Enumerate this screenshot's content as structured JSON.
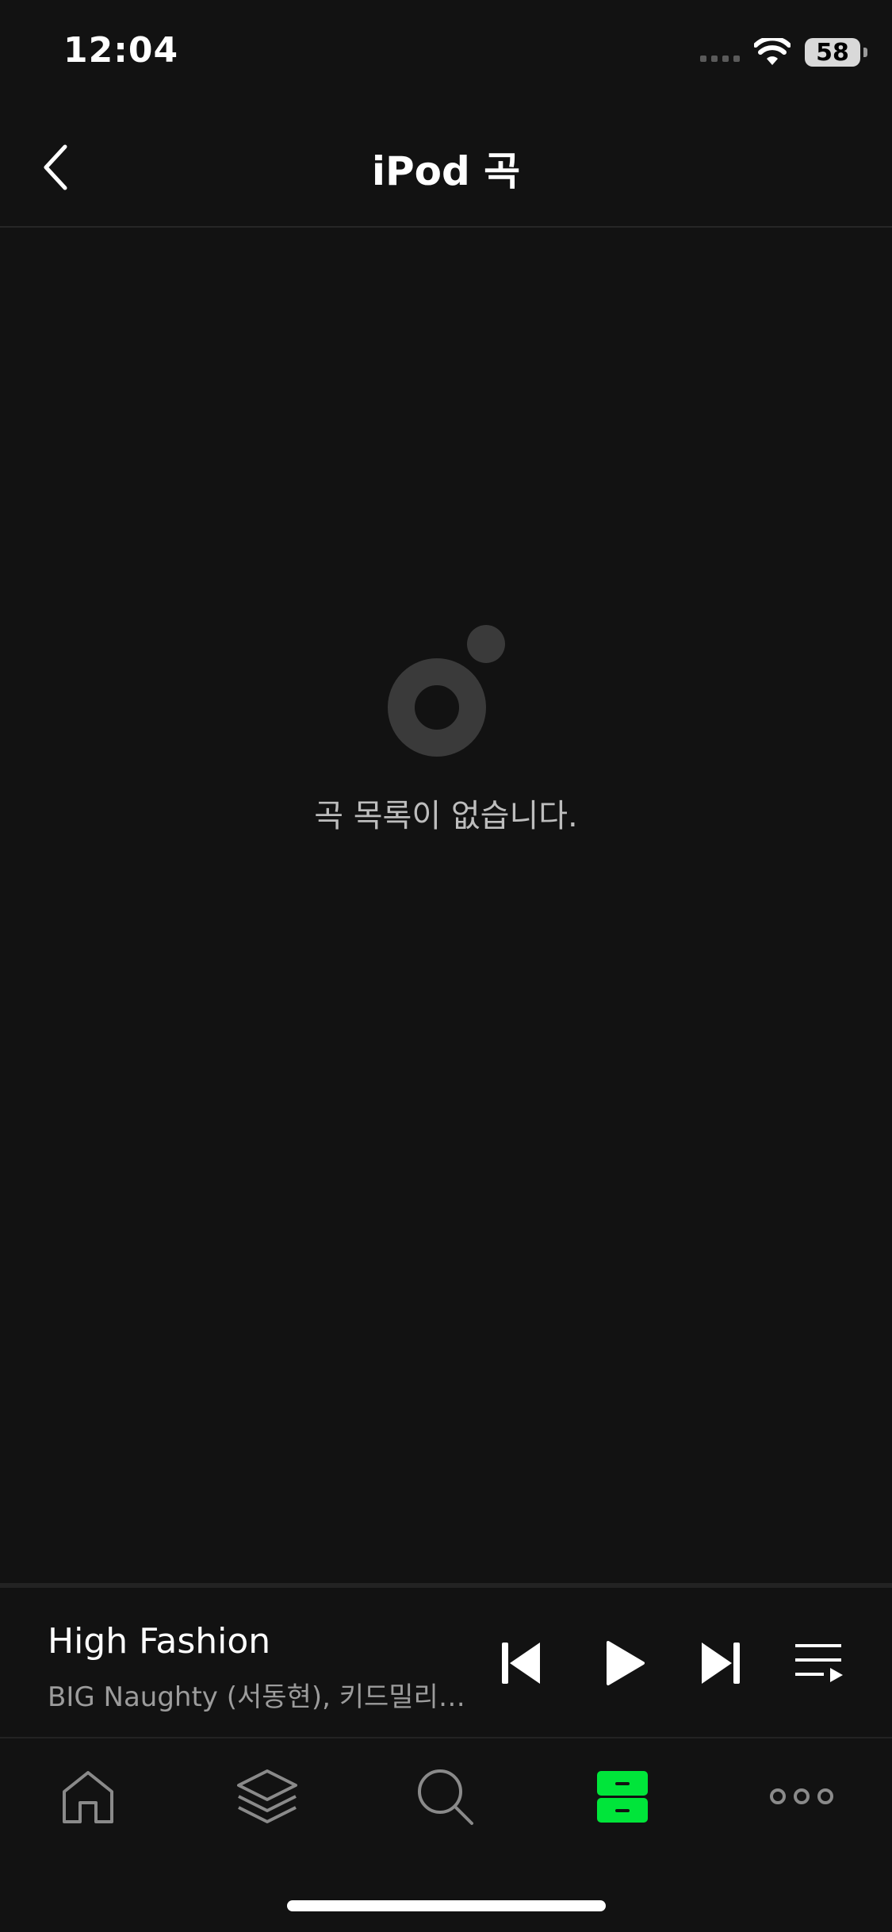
{
  "status_bar": {
    "time": "12:04",
    "battery": "58"
  },
  "header": {
    "title": "iPod 곡",
    "back_icon": "chevron-left-icon"
  },
  "empty_state": {
    "icon": "app-logo-icon",
    "message": "곡 목록이 없습니다."
  },
  "mini_player": {
    "title": "High Fashion",
    "artist": "BIG Naughty (서동현), 키드밀리…",
    "controls": [
      "previous-icon",
      "play-icon",
      "next-icon",
      "playlist-icon"
    ]
  },
  "tab_bar": {
    "tabs": [
      {
        "icon": "home-icon",
        "active": false
      },
      {
        "icon": "layers-icon",
        "active": false
      },
      {
        "icon": "search-icon",
        "active": false
      },
      {
        "icon": "library-icon",
        "active": true
      },
      {
        "icon": "more-icon",
        "active": false
      }
    ],
    "accent_color": "#00e53a"
  }
}
